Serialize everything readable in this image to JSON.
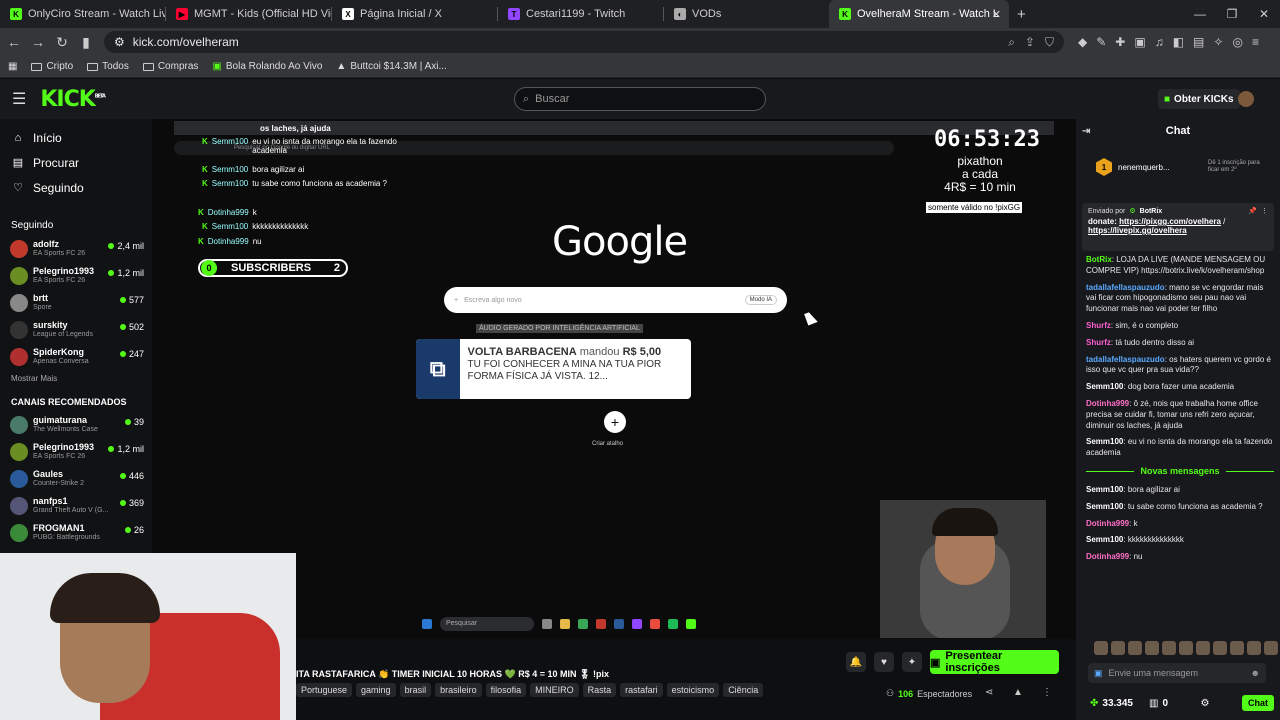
{
  "browser": {
    "tabs": [
      {
        "label": "OnlyCiro Stream - Watch Live on Kick",
        "fav": "K",
        "fav_color": "#53fc18"
      },
      {
        "label": "MGMT - Kids (Official HD Video) - Yo",
        "fav": "▶",
        "fav_color": "#ff0033"
      },
      {
        "label": "Página Inicial / X",
        "fav": "X",
        "fav_color": "#ffffff"
      },
      {
        "label": "Cestari1199 - Twitch",
        "fav": "T",
        "fav_color": "#9146ff"
      },
      {
        "label": "VODs",
        "fav": "◐",
        "fav_color": "#aaaaaa"
      },
      {
        "label": "OvelheraM Stream - Watch L",
        "fav": "K",
        "fav_color": "#53fc18",
        "active": true
      }
    ],
    "url": "kick.com/ovelheram",
    "bookmarks": [
      "Cripto",
      "Todos",
      "Compras",
      "Bola Rolando Ao Vivo",
      "Buttcoi $14.3M | Axi..."
    ]
  },
  "header": {
    "logo": "KICK",
    "logo_sup": "BETA",
    "search_placeholder": "Buscar",
    "get_kicks": "Obter KICKs"
  },
  "sidebar": {
    "nav": [
      {
        "label": "Início",
        "icon": "home-icon"
      },
      {
        "label": "Procurar",
        "icon": "browse-icon"
      },
      {
        "label": "Seguindo",
        "icon": "heart-icon"
      }
    ],
    "following_title": "Seguindo",
    "following": [
      {
        "name": "adolfz",
        "game": "EA Sports FC 26",
        "viewers": "2,4 mil",
        "color": "#c0392b"
      },
      {
        "name": "Pelegrino1993",
        "game": "EA Sports FC 26",
        "viewers": "1,2 mil",
        "color": "#6b8e23"
      },
      {
        "name": "brtt",
        "game": "Spore",
        "viewers": "577",
        "color": "#888888"
      },
      {
        "name": "surskity",
        "game": "League of Legends",
        "viewers": "502",
        "color": "#333333"
      },
      {
        "name": "SpiderKong",
        "game": "Apenas Conversa",
        "viewers": "247",
        "color": "#b03030"
      }
    ],
    "show_more": "Mostrar Mais",
    "recommended_title": "CANAIS RECOMENDADOS",
    "recommended": [
      {
        "name": "guimaturana",
        "game": "The Wellmonts Case",
        "viewers": "39",
        "color": "#4a7a6a"
      },
      {
        "name": "Pelegrino1993",
        "game": "EA Sports FC 26",
        "viewers": "1,2 mil",
        "color": "#6b8e23"
      },
      {
        "name": "Gaules",
        "game": "Counter-Strike 2",
        "viewers": "446",
        "color": "#2a5a9a"
      },
      {
        "name": "nanfps1",
        "game": "Grand Theft Auto V (G...",
        "viewers": "369",
        "color": "#555577"
      },
      {
        "name": "FROGMAN1",
        "game": "PUBG: Battlegrounds",
        "viewers": "26",
        "color": "#3a8a3a"
      }
    ]
  },
  "stream": {
    "inner_tab": "os laches, já ajuda",
    "inner_url": "Pesquisar no Google ou digitar URL",
    "overlay_chat": [
      {
        "user": "Semm100",
        "text": "eu vi no isnta da morango ela ta fazendo academia"
      },
      {
        "user": "Semm100",
        "text": "bora agilizar ai"
      },
      {
        "user": "Semm100",
        "text": "tu sabe como funciona as academia ?"
      },
      {
        "user": "Dotinha999",
        "text": "k"
      },
      {
        "user": "Semm100",
        "text": "kkkkkkkkkkkkkk"
      },
      {
        "user": "Dotinha999",
        "text": "nu"
      }
    ],
    "subs_zero": "0",
    "subs_label": "SUBSCRIBERS",
    "subs_count": "2",
    "timer": "06:53:23",
    "overlay_lines": [
      "pixathon",
      "a cada",
      "4R$ = 10 min"
    ],
    "overlay_small": "somente válido no !pixGG",
    "google": "Google",
    "google_search": "Escreva algo novo",
    "google_mode": "Modo IA",
    "ai_label": "ÁUDIO GERADO POR INTELIGÊNCIA ARTIFICIAL",
    "alert": {
      "donor": "VOLTA BARBACENA",
      "verb": "mandou",
      "amount": "R$ 5,00",
      "message": "TU FOI CONHECER A MINA NA TUA PIOR FORMA FÍSICA JÁ VISTA. 12..."
    },
    "shortcut_label": "Criar atalho",
    "taskbar_search": "Pesquisar"
  },
  "below": {
    "title": "ITA RASTAFARICA 👏 TIMER INICIAL 10 HORAS 💚 R$ 4 = 10 MIN 🎖 !pix",
    "tags": [
      "Portuguese",
      "gaming",
      "brasil",
      "brasileiro",
      "filosofia",
      "MINEIRO",
      "Rasta",
      "rastafari",
      "estoicismo",
      "Ciência"
    ],
    "gift_button": "Presentear inscrições",
    "viewers_count": "106",
    "viewers_label": "Espectadores"
  },
  "chat": {
    "title": "Chat",
    "goal_user": "nenemquerb...",
    "goal_text": "Dê 1 inscrição para ficar em 2º",
    "pinned_by_label": "Enviado por",
    "pinned_by": "BotRix",
    "pinned_prefix": "donate:",
    "pinned_link1": "https://pixgg.com/ovelhera",
    "pinned_sep": "/",
    "pinned_link2": "https://livepix.gg/ovelhera",
    "messages": [
      {
        "user": "BotRix",
        "color": "#53fc18",
        "text": "LOJA DA LIVE (MANDE MENSAGEM OU COMPRE VIP) https://botrix.live/k/ovelheram/shop"
      },
      {
        "user": "tadallafellaspauzudo",
        "color": "#5aa9ff",
        "text": "mano se vc engordar mais vai ficar com hipogonadismo seu pau nao vai funcionar mais nao vai poder ter filho"
      },
      {
        "user": "Shurfz",
        "color": "#ff5fd2",
        "text": "sim, é o completo"
      },
      {
        "user": "Shurfz",
        "color": "#ff5fd2",
        "text": "tá tudo dentro disso ai"
      },
      {
        "user": "tadallafellaspauzudo",
        "color": "#5aa9ff",
        "text": "os haters querem vc gordo é isso que vc quer pra sua vida??"
      },
      {
        "user": "Semm100",
        "color": "#ffffff",
        "text": "dog bora fazer uma academia"
      },
      {
        "user": "Dotinha999",
        "color": "#ff6ec7",
        "text": "ô zé, nois que trabalha home office precisa se cuidar fi, tomar uns refri zero açucar, diminuir os laches, já ajuda"
      },
      {
        "user": "Semm100",
        "color": "#ffffff",
        "text": "eu vi no isnta da morango ela ta fazendo academia"
      }
    ],
    "new_messages": "Novas mensagens",
    "messages_new": [
      {
        "user": "Semm100",
        "color": "#ffffff",
        "text": "bora agilizar ai"
      },
      {
        "user": "Semm100",
        "color": "#ffffff",
        "text": "tu sabe como funciona as academia ?"
      },
      {
        "user": "Dotinha999",
        "color": "#ff6ec7",
        "text": "k"
      },
      {
        "user": "Semm100",
        "color": "#ffffff",
        "text": "kkkkkkkkkkkkkk"
      },
      {
        "user": "Dotinha999",
        "color": "#ff6ec7",
        "text": "nu"
      }
    ],
    "input_placeholder": "Envie uma mensagem",
    "points": "33.345",
    "zero": "0",
    "chat_button": "Chat"
  }
}
